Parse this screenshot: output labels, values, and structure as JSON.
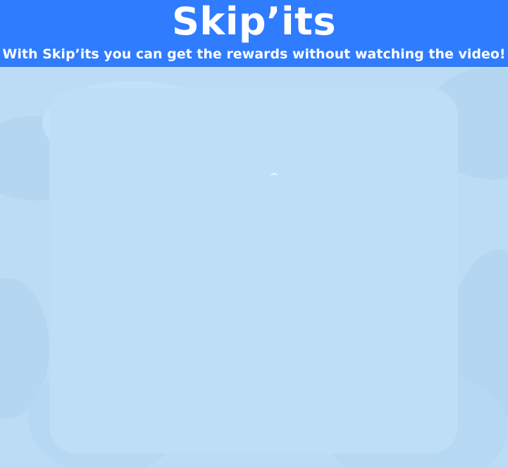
{
  "header": {
    "title": "Skip’its",
    "subtitle": "With Skip’its you can get the rewards without watching the video!"
  },
  "content": {
    "state": "loading",
    "indicator_icon": "loading-spinner-icon"
  },
  "colors": {
    "header_bg": "#2f7cff",
    "header_text": "#ffffff",
    "panel_bg": "#bcdcf5"
  }
}
